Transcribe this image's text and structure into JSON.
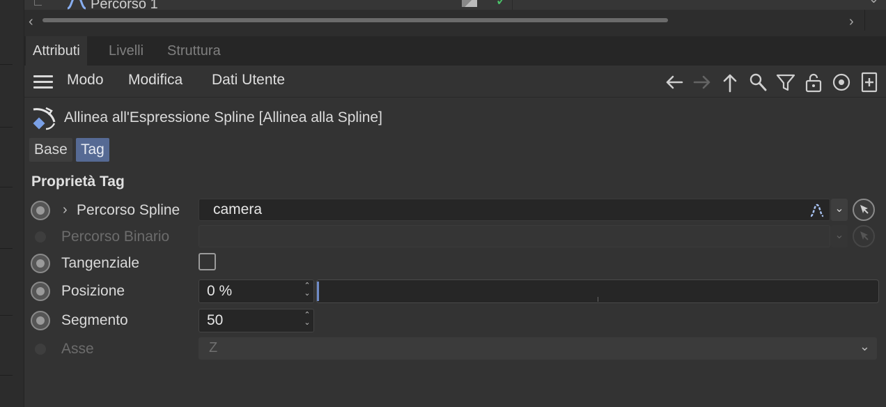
{
  "object_manager": {
    "object_name": "Percorso 1"
  },
  "tabs": [
    "Attributi",
    "Livelli",
    "Struttura"
  ],
  "menu": {
    "items": [
      "Modo",
      "Modifica",
      "Dati Utente"
    ]
  },
  "toolbar_icons": [
    "arrow-left-icon",
    "arrow-right-icon",
    "arrow-up-icon",
    "search-icon",
    "filter-icon",
    "lock-icon",
    "target-icon",
    "new-panel-icon"
  ],
  "tag": {
    "title": "Allinea all'Espressione Spline [Allinea alla Spline]",
    "subtabs": [
      "Base",
      "Tag"
    ],
    "active_subtab": "Tag",
    "section_title": "Proprietà Tag"
  },
  "properties": {
    "spline_path": {
      "label": "Percorso Spline",
      "value": "camera"
    },
    "rail_path": {
      "label": "Percorso Binario",
      "value": ""
    },
    "tangential": {
      "label": "Tangenziale",
      "checked": false
    },
    "position": {
      "label": "Posizione",
      "value": "0 %",
      "fraction": 0.0
    },
    "segment": {
      "label": "Segmento",
      "value": "50"
    },
    "axis": {
      "label": "Asse",
      "value": "Z"
    }
  },
  "colors": {
    "accent": "#566a94",
    "slider_handle": "#6f8bc7",
    "check_green": "#4bc46a"
  }
}
